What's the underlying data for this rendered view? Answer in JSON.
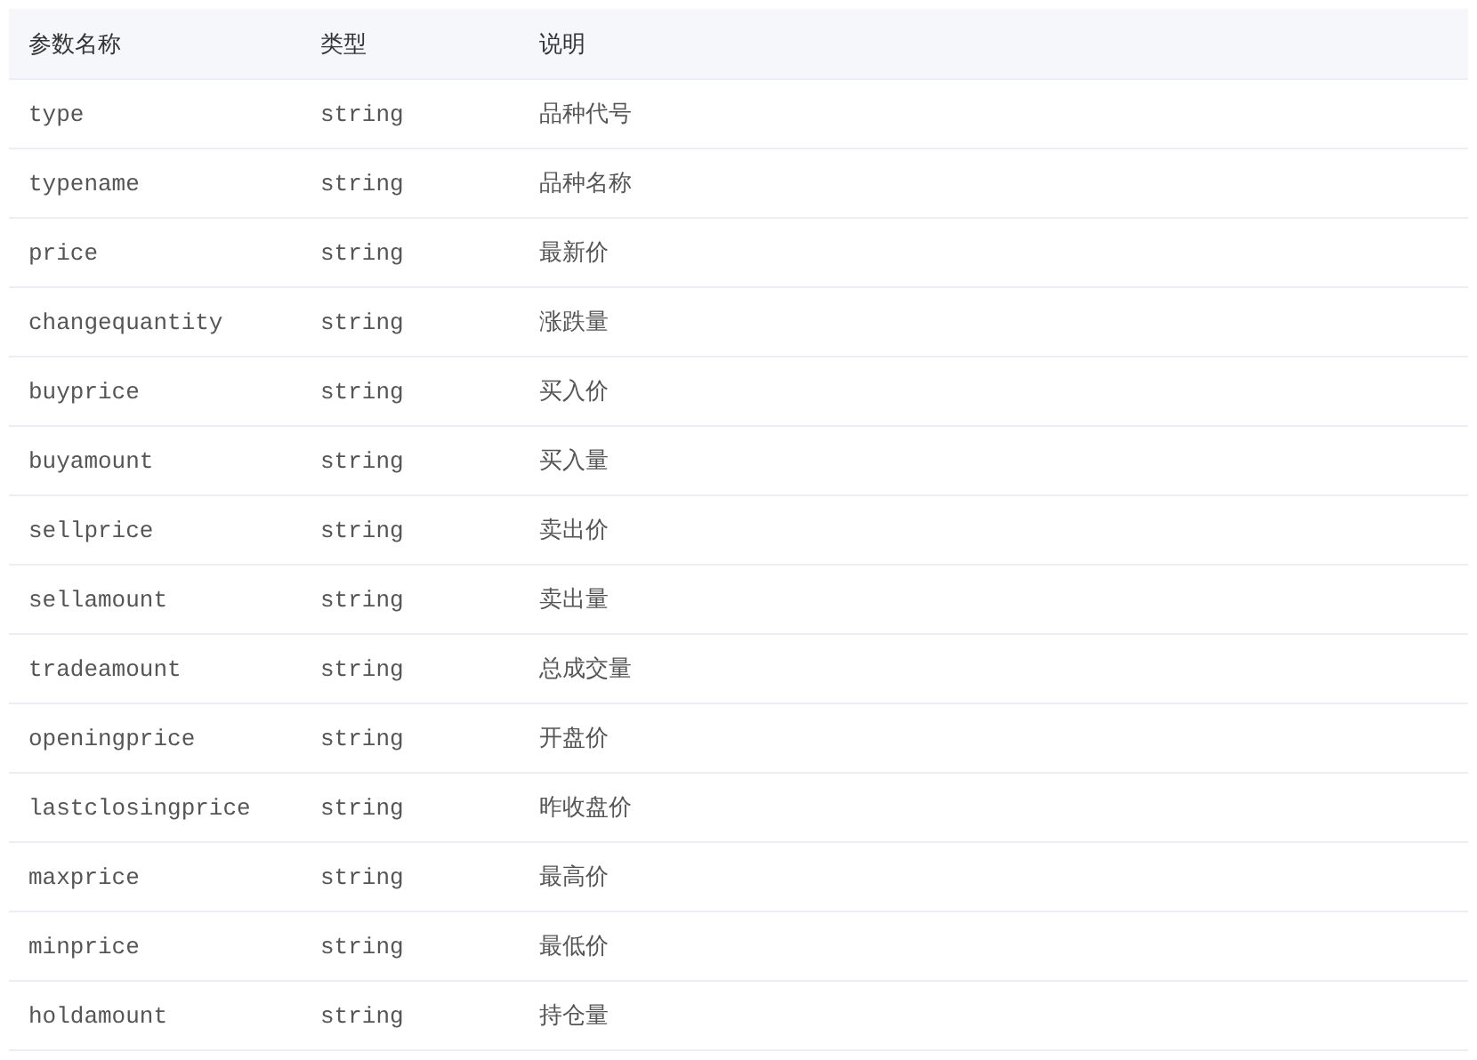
{
  "table": {
    "columns": [
      "参数名称",
      "类型",
      "说明"
    ],
    "rows": [
      [
        "type",
        "string",
        "品种代号"
      ],
      [
        "typename",
        "string",
        "品种名称"
      ],
      [
        "price",
        "string",
        "最新价"
      ],
      [
        "changequantity",
        "string",
        "涨跌量"
      ],
      [
        "buyprice",
        "string",
        "买入价"
      ],
      [
        "buyamount",
        "string",
        "买入量"
      ],
      [
        "sellprice",
        "string",
        "卖出价"
      ],
      [
        "sellamount",
        "string",
        "卖出量"
      ],
      [
        "tradeamount",
        "string",
        "总成交量"
      ],
      [
        "openingprice",
        "string",
        "开盘价"
      ],
      [
        "lastclosingprice",
        "string",
        "昨收盘价"
      ],
      [
        "maxprice",
        "string",
        "最高价"
      ],
      [
        "minprice",
        "string",
        "最低价"
      ],
      [
        "holdamount",
        "string",
        "持仓量"
      ]
    ]
  }
}
